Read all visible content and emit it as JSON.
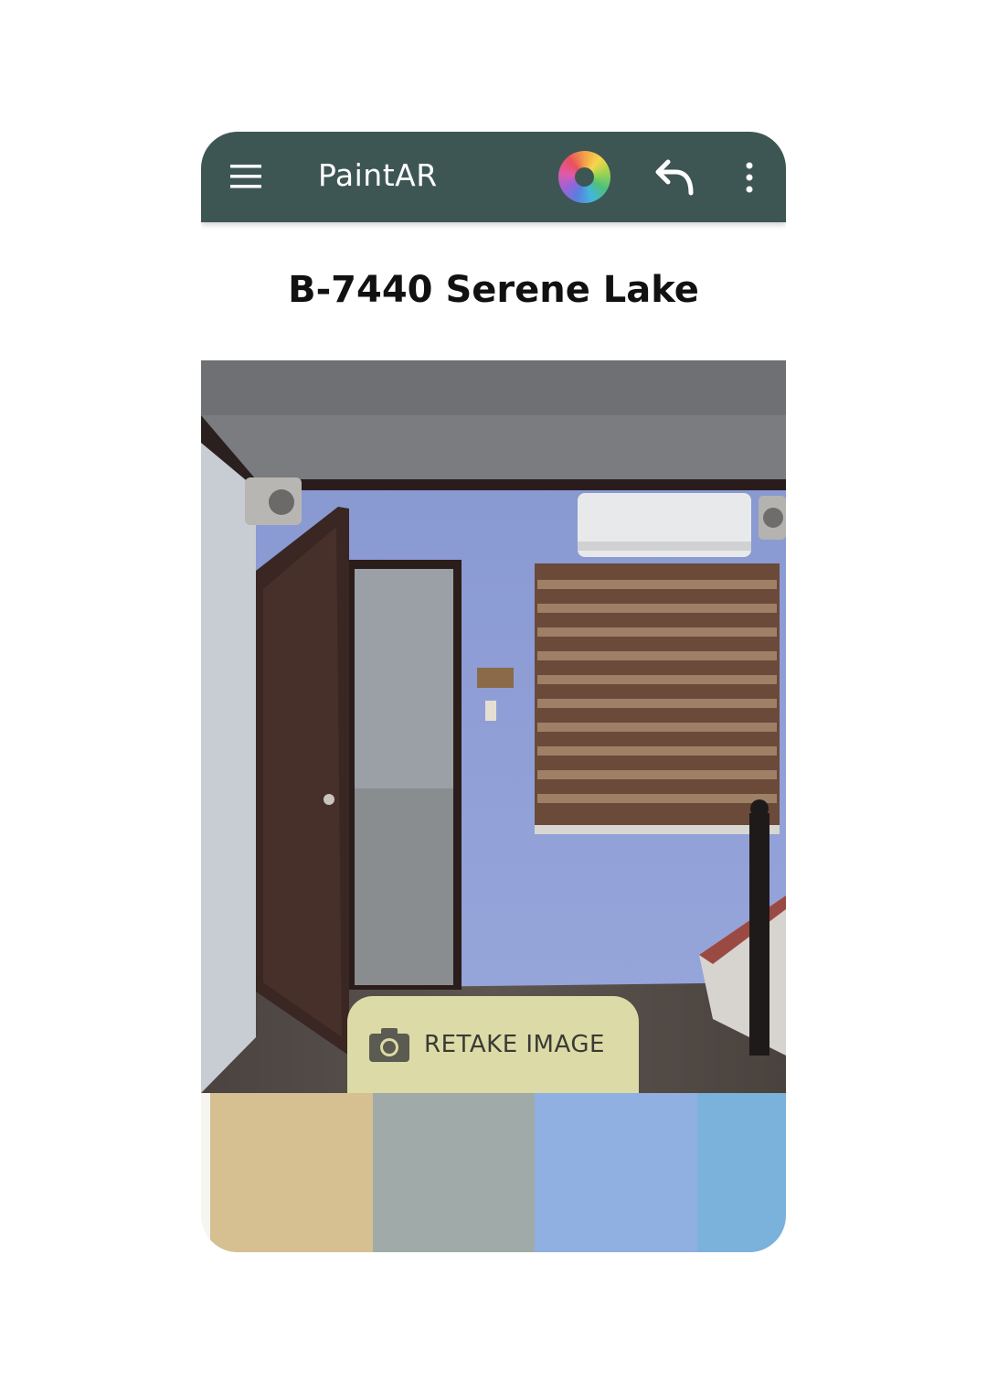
{
  "appbar": {
    "title": "PaintAR",
    "background": "#3d5654",
    "menu_icon": "hamburger-menu-icon",
    "palette_icon": "color-wheel-icon",
    "undo_icon": "undo-arrow-icon",
    "overflow_icon": "more-vertical-icon"
  },
  "color": {
    "title": "B-7440 Serene Lake"
  },
  "retake": {
    "label": "RETAKE IMAGE",
    "icon": "camera-icon",
    "background": "#dcdaa6"
  },
  "swatches": [
    {
      "color": "#d6bf91"
    },
    {
      "color": "#a0aaa8"
    },
    {
      "color": "#8fb0e0"
    },
    {
      "color": "#7ab2dc"
    }
  ]
}
